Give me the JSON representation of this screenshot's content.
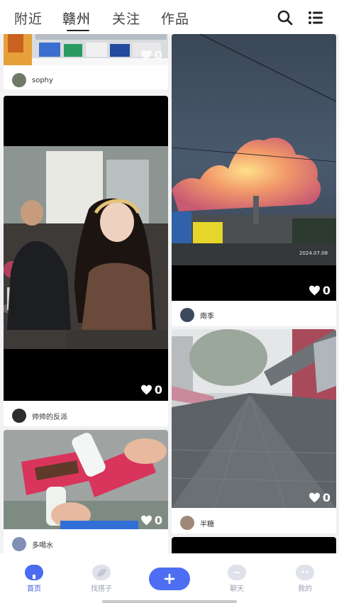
{
  "header": {
    "tabs": [
      {
        "label": "附近",
        "active": false
      },
      {
        "label": "赣州",
        "active": true
      },
      {
        "label": "关注",
        "active": false
      },
      {
        "label": "作品",
        "active": false
      }
    ],
    "icons": [
      "search-icon",
      "menu-list-icon"
    ]
  },
  "feed": {
    "cards": [
      {
        "author": "sophy",
        "likes": "0",
        "image": "snack-shelf"
      },
      {
        "author": "帅帅的反派",
        "likes": "0",
        "image": "girl-in-cafe"
      },
      {
        "author": "多喝水",
        "likes": "0",
        "image": "ice-cream-snacks"
      },
      {
        "author": "南季",
        "likes": "0",
        "image": "sunset-cloud",
        "photo_stamp": "2024.07.08"
      },
      {
        "author": "半糖",
        "likes": "0",
        "image": "rainy-street"
      }
    ]
  },
  "nav": {
    "items": [
      {
        "label": "首页",
        "active": true
      },
      {
        "label": "找搭子",
        "active": false
      },
      {
        "label": "聊天",
        "active": false
      },
      {
        "label": "我的",
        "active": false
      }
    ],
    "plus_symbol": "+"
  },
  "colors": {
    "accent": "#4a6cf0",
    "background": "#f2f2f4"
  }
}
